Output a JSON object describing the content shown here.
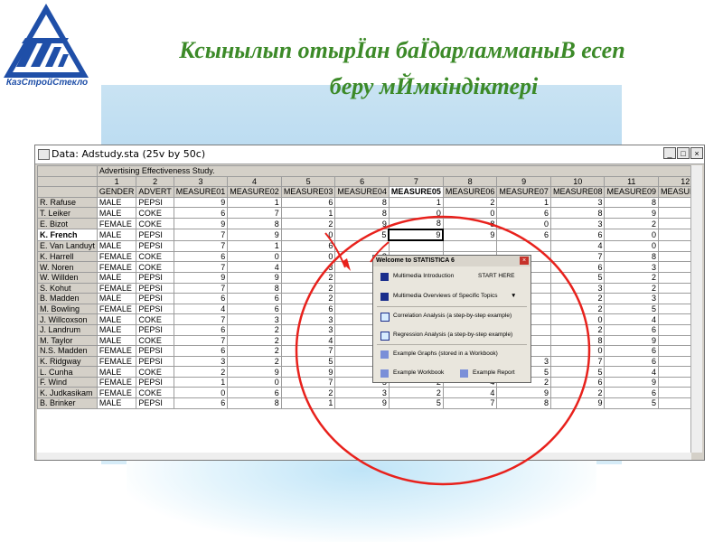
{
  "slide": {
    "title_line1": "Ксынылып отырЇан баЇдарламманыВ есеп",
    "title_line2": "беру мЙмкiндiктерi",
    "logo_text": "КазСтройСтекло",
    "accent_color": "#3c8a28",
    "logo_color": "#1f4fa8",
    "annotation_color": "#e8211c"
  },
  "window": {
    "title": "Data: Adstudy.sta (25v by 50c)",
    "minimize_label": "_",
    "maximize_label": "□",
    "close_label": "×"
  },
  "grid": {
    "caption": "Advertising Effectiveness Study.",
    "columns": [
      {
        "num": "1",
        "name": "GENDER"
      },
      {
        "num": "2",
        "name": "ADVERT"
      },
      {
        "num": "3",
        "name": "MEASURE01"
      },
      {
        "num": "4",
        "name": "MEASURE02"
      },
      {
        "num": "5",
        "name": "MEASURE03"
      },
      {
        "num": "6",
        "name": "MEASURE04"
      },
      {
        "num": "7",
        "name": "MEASURE05"
      },
      {
        "num": "8",
        "name": "MEASURE06"
      },
      {
        "num": "9",
        "name": "MEASURE07"
      },
      {
        "num": "10",
        "name": "MEASURE08"
      },
      {
        "num": "11",
        "name": "MEASURE09"
      },
      {
        "num": "12",
        "name": "MEASURE10"
      },
      {
        "num": "",
        "name": "ME"
      }
    ],
    "rows": [
      {
        "name": "R. Rafuse",
        "cells": [
          "MALE",
          "PEPSI",
          "9",
          "1",
          "6",
          "8",
          "1",
          "2",
          "1",
          "3",
          "8",
          "2",
          ""
        ]
      },
      {
        "name": "T. Leiker",
        "cells": [
          "MALE",
          "COKE",
          "6",
          "7",
          "1",
          "8",
          "0",
          "0",
          "6",
          "8",
          "9",
          "9",
          ""
        ]
      },
      {
        "name": "E. Bizot",
        "cells": [
          "FEMALE",
          "COKE",
          "9",
          "8",
          "2",
          "9",
          "8",
          "8",
          "0",
          "3",
          "2",
          "2",
          ""
        ]
      },
      {
        "name": "K. French",
        "cells": [
          "MALE",
          "PEPSI",
          "7",
          "9",
          "0",
          "5",
          "9",
          "9",
          "6",
          "6",
          "0",
          "7",
          ""
        ]
      },
      {
        "name": "E. Van Landuyt",
        "cells": [
          "MALE",
          "PEPSI",
          "7",
          "1",
          "6",
          "",
          "",
          "",
          "",
          "4",
          "0",
          "7",
          ""
        ]
      },
      {
        "name": "K. Harrell",
        "cells": [
          "FEMALE",
          "COKE",
          "6",
          "0",
          "0",
          "8",
          "",
          "",
          "",
          "7",
          "8",
          "7",
          ""
        ]
      },
      {
        "name": "W. Noren",
        "cells": [
          "FEMALE",
          "COKE",
          "7",
          "4",
          "3",
          "",
          "",
          "",
          "",
          "6",
          "3",
          "9",
          ""
        ]
      },
      {
        "name": "W. Willden",
        "cells": [
          "MALE",
          "PEPSI",
          "9",
          "9",
          "2",
          "6",
          "",
          "",
          "",
          "5",
          "2",
          "4",
          ""
        ]
      },
      {
        "name": "S. Kohut",
        "cells": [
          "FEMALE",
          "PEPSI",
          "7",
          "8",
          "2",
          "3",
          "",
          "",
          "",
          "3",
          "2",
          "9",
          ""
        ]
      },
      {
        "name": "B. Madden",
        "cells": [
          "MALE",
          "PEPSI",
          "6",
          "6",
          "2",
          "8",
          "",
          "",
          "",
          "2",
          "3",
          "0",
          ""
        ]
      },
      {
        "name": "M. Bowling",
        "cells": [
          "FEMALE",
          "PEPSI",
          "4",
          "6",
          "6",
          "5",
          "",
          "",
          "",
          "2",
          "5",
          "8",
          ""
        ]
      },
      {
        "name": "J. Willcoxson",
        "cells": [
          "MALE",
          "COKE",
          "7",
          "3",
          "3",
          "7",
          "",
          "",
          "",
          "0",
          "4",
          "1",
          ""
        ]
      },
      {
        "name": "J. Landrum",
        "cells": [
          "MALE",
          "PEPSI",
          "6",
          "2",
          "3",
          "7",
          "",
          "",
          "",
          "2",
          "6",
          "2",
          ""
        ]
      },
      {
        "name": "M. Taylor",
        "cells": [
          "MALE",
          "COKE",
          "7",
          "2",
          "4",
          "8",
          "",
          "",
          "",
          "8",
          "9",
          "4",
          ""
        ]
      },
      {
        "name": "N.S. Madden",
        "cells": [
          "FEMALE",
          "PEPSI",
          "6",
          "2",
          "7",
          "5",
          "",
          "",
          "",
          "0",
          "6",
          "5",
          ""
        ]
      },
      {
        "name": "K. Ridgway",
        "cells": [
          "FEMALE",
          "PEPSI",
          "3",
          "2",
          "5",
          "4",
          "4",
          "4",
          "3",
          "7",
          "6",
          "5",
          ""
        ]
      },
      {
        "name": "L. Cunha",
        "cells": [
          "MALE",
          "COKE",
          "2",
          "9",
          "9",
          "3",
          "1",
          "4",
          "5",
          "5",
          "4",
          "3",
          ""
        ]
      },
      {
        "name": "F. Wind",
        "cells": [
          "FEMALE",
          "PEPSI",
          "1",
          "0",
          "7",
          "5",
          "2",
          "4",
          "2",
          "6",
          "9",
          "2",
          ""
        ]
      },
      {
        "name": "K. Judkasikam",
        "cells": [
          "FEMALE",
          "COKE",
          "0",
          "6",
          "2",
          "3",
          "2",
          "4",
          "9",
          "2",
          "6",
          "7",
          ""
        ]
      },
      {
        "name": "B. Brinker",
        "cells": [
          "MALE",
          "PEPSI",
          "6",
          "8",
          "1",
          "9",
          "5",
          "7",
          "8",
          "9",
          "5",
          "8",
          ""
        ]
      }
    ]
  },
  "popup": {
    "title": "Welcome to STATISTICA 6",
    "close_label": "×",
    "items": {
      "multimedia_intro": "Multimedia Introduction",
      "start_here": "START HERE",
      "multimedia_overviews": "Multimedia Overviews of Specific Topics",
      "dropdown_arrow": "▼",
      "correlation": "Correlation Analysis (a step-by-step example)",
      "regression": "Regression Analysis (a step-by-step example)",
      "example_graphs": "Example Graphs (stored in a Workbook)",
      "example_workbook": "Example Workbook",
      "example_report": "Example Report"
    }
  }
}
